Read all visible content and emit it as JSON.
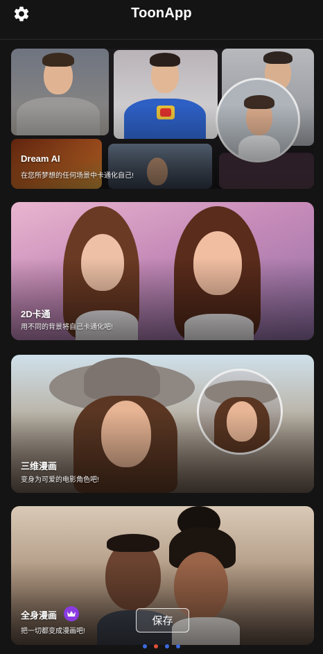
{
  "header": {
    "title": "ToonApp",
    "settings_icon": "gear-icon"
  },
  "cards": [
    {
      "title": "Dream AI",
      "subtitle": "在您所梦想的任何场景中卡通化自己!"
    },
    {
      "title": "2D卡通",
      "subtitle": "用不同的背景将自己卡通化吧!"
    },
    {
      "title": "三维漫画",
      "subtitle": "变身为可爱的电影角色吧!"
    },
    {
      "title": "全身漫画",
      "subtitle": "把一切都变成漫画吧!",
      "badge_icon": "crown-icon"
    }
  ],
  "save_button": {
    "label": "保存"
  },
  "pager": {
    "count": 4,
    "active_index": 1
  },
  "colors": {
    "background": "#141414",
    "premium_badge": "#8a3be0",
    "dot_active": "#e0503c",
    "dot_inactive": "#3c6ae0"
  }
}
